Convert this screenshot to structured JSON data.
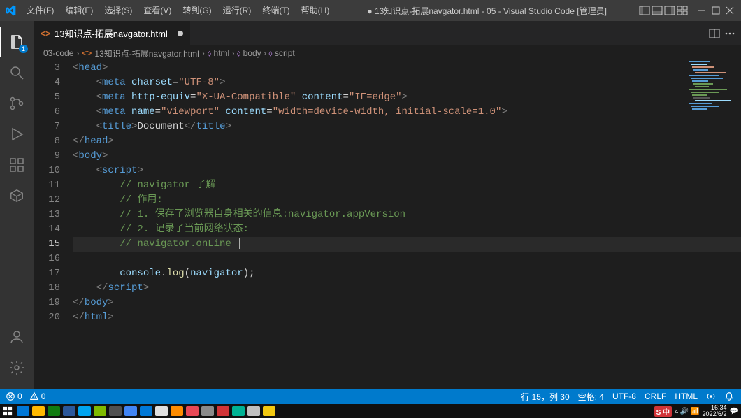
{
  "menubar": {
    "items": [
      "文件(F)",
      "编辑(E)",
      "选择(S)",
      "查看(V)",
      "转到(G)",
      "运行(R)",
      "终端(T)",
      "帮助(H)"
    ],
    "title": "● 13知识点-拓展navgator.html - 05 - Visual Studio Code [管理员]"
  },
  "tab": {
    "label": "13知识点-拓展navgator.html"
  },
  "breadcrumb": {
    "folder": "03-code",
    "file": "13知识点-拓展navgator.html",
    "path": [
      "html",
      "body",
      "script"
    ]
  },
  "activitybar": {
    "badge": "1"
  },
  "gutter_start": 3,
  "code_lines": [
    {
      "n": 3,
      "html": "<span class='tag-bracket'>&lt;</span><span class='tag-name'>head</span><span class='tag-bracket'>&gt;</span>"
    },
    {
      "n": 4,
      "html": "    <span class='tag-bracket'>&lt;</span><span class='tag-name'>meta</span> <span class='attr-name'>charset</span><span class='punct'>=</span><span class='attr-val'>\"UTF-8\"</span><span class='tag-bracket'>&gt;</span>"
    },
    {
      "n": 5,
      "html": "    <span class='tag-bracket'>&lt;</span><span class='tag-name'>meta</span> <span class='attr-name'>http-equiv</span><span class='punct'>=</span><span class='attr-val'>\"X-UA-Compatible\"</span> <span class='attr-name'>content</span><span class='punct'>=</span><span class='attr-val'>\"IE=edge\"</span><span class='tag-bracket'>&gt;</span>"
    },
    {
      "n": 6,
      "html": "    <span class='tag-bracket'>&lt;</span><span class='tag-name'>meta</span> <span class='attr-name'>name</span><span class='punct'>=</span><span class='attr-val'>\"viewport\"</span> <span class='attr-name'>content</span><span class='punct'>=</span><span class='attr-val'>\"width=device-width, initial-scale=1.0\"</span><span class='tag-bracket'>&gt;</span>"
    },
    {
      "n": 7,
      "html": "    <span class='tag-bracket'>&lt;</span><span class='tag-name'>title</span><span class='tag-bracket'>&gt;</span><span class='punct'>Document</span><span class='tag-bracket'>&lt;/</span><span class='tag-name'>title</span><span class='tag-bracket'>&gt;</span>"
    },
    {
      "n": 8,
      "html": "<span class='tag-bracket'>&lt;/</span><span class='tag-name'>head</span><span class='tag-bracket'>&gt;</span>"
    },
    {
      "n": 9,
      "html": "<span class='tag-bracket'>&lt;</span><span class='tag-name'>body</span><span class='tag-bracket'>&gt;</span>"
    },
    {
      "n": 10,
      "html": "    <span class='tag-bracket'>&lt;</span><span class='tag-name'>script</span><span class='tag-bracket'>&gt;</span>"
    },
    {
      "n": 11,
      "html": "        <span class='comment'>// navigator 了解</span>"
    },
    {
      "n": 12,
      "html": "        <span class='comment'>// 作用:</span>"
    },
    {
      "n": 13,
      "html": "        <span class='comment'>// 1. 保存了浏览器自身相关的信息:navigator.appVersion</span>"
    },
    {
      "n": 14,
      "html": "        <span class='comment'>// 2. 记录了当前网络状态:</span>"
    },
    {
      "n": 15,
      "html": "        <span class='comment'>// navigator.onLine </span><span class='cursor'></span>",
      "current": true
    },
    {
      "n": 16,
      "html": ""
    },
    {
      "n": 17,
      "html": "        <span class='ident'>console</span><span class='punct'>.</span><span class='method'>log</span><span class='punct'>(</span><span class='ident'>navigator</span><span class='punct'>);</span>"
    },
    {
      "n": 18,
      "html": "    <span class='tag-bracket'>&lt;/</span><span class='tag-name'>script</span><span class='tag-bracket'>&gt;</span>"
    },
    {
      "n": 19,
      "html": "<span class='tag-bracket'>&lt;/</span><span class='tag-name'>body</span><span class='tag-bracket'>&gt;</span>"
    },
    {
      "n": 20,
      "html": "<span class='tag-bracket'>&lt;/</span><span class='tag-name'>html</span><span class='tag-bracket'>&gt;</span>"
    }
  ],
  "statusbar": {
    "errors": "0",
    "warnings": "0",
    "lineCol": "行 15，列 30",
    "spaces": "空格: 4",
    "encoding": "UTF-8",
    "eol": "CRLF",
    "lang": "HTML"
  },
  "tray": {
    "ime": "S 中",
    "time": "16:34",
    "date": "2022/6/2"
  },
  "taskbar_colors": [
    "#0078d7",
    "#ffb900",
    "#107c10",
    "#2b579a",
    "#00a4ef",
    "#7fba00",
    "#505050",
    "#4285f4",
    "#0078d7",
    "#e0e0e0",
    "#ff8c00",
    "#e74856",
    "#8a8a8a",
    "#d13438",
    "#00b294",
    "#c0c0c0",
    "#f2c811"
  ]
}
